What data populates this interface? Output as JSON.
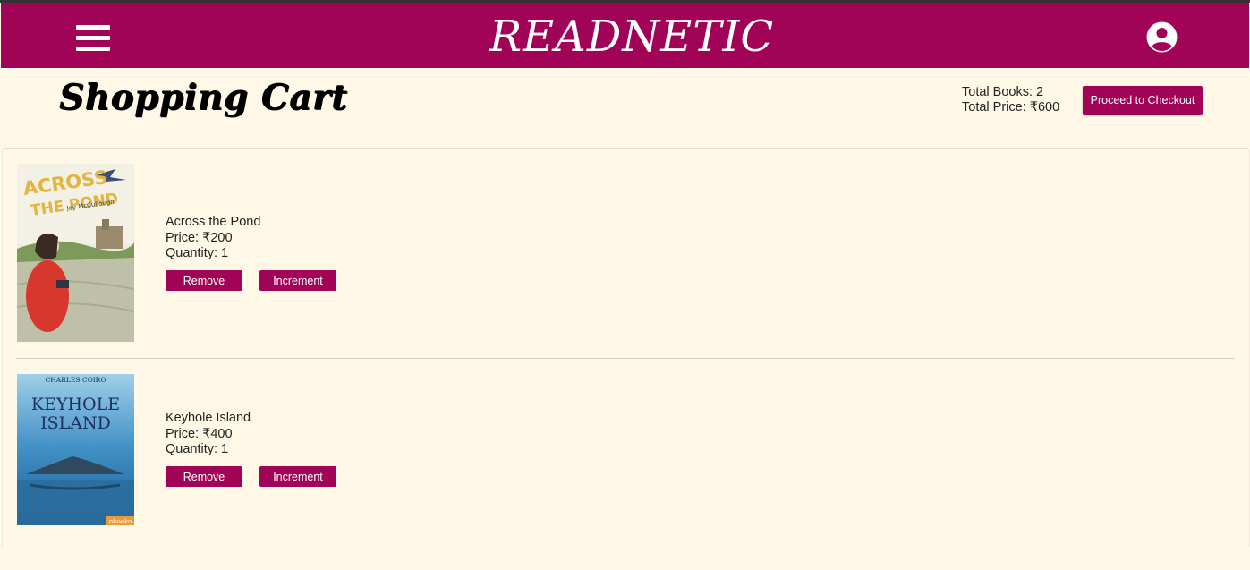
{
  "header": {
    "logo_text": "READNETIC",
    "menu_icon": "hamburger-menu-icon",
    "account_icon": "user-circle-icon",
    "bg_color": "#a10456"
  },
  "page": {
    "title": "Shopping Cart",
    "total_books_label": "Total Books: 2",
    "total_price_label": "Total Price: ₹600",
    "checkout_label": "Proceed to Checkout"
  },
  "cart": {
    "items": [
      {
        "title": "Across the Pond",
        "price_label": "Price: ₹200",
        "quantity_label": "Quantity: 1",
        "remove_label": "Remove",
        "increment_label": "Increment",
        "cover": {
          "title_line1": "ACROSS",
          "title_line2": "THE POND",
          "author": "Joy McCullough"
        }
      },
      {
        "title": "Keyhole Island",
        "price_label": "Price: ₹400",
        "quantity_label": "Quantity: 1",
        "remove_label": "Remove",
        "increment_label": "Increment",
        "cover": {
          "author": "CHARLES COIRO",
          "title_line1": "KEYHOLE",
          "title_line2": "ISLAND",
          "publisher": "obooko"
        }
      }
    ]
  },
  "colors": {
    "accent": "#a10456",
    "background": "#fff8e6"
  }
}
